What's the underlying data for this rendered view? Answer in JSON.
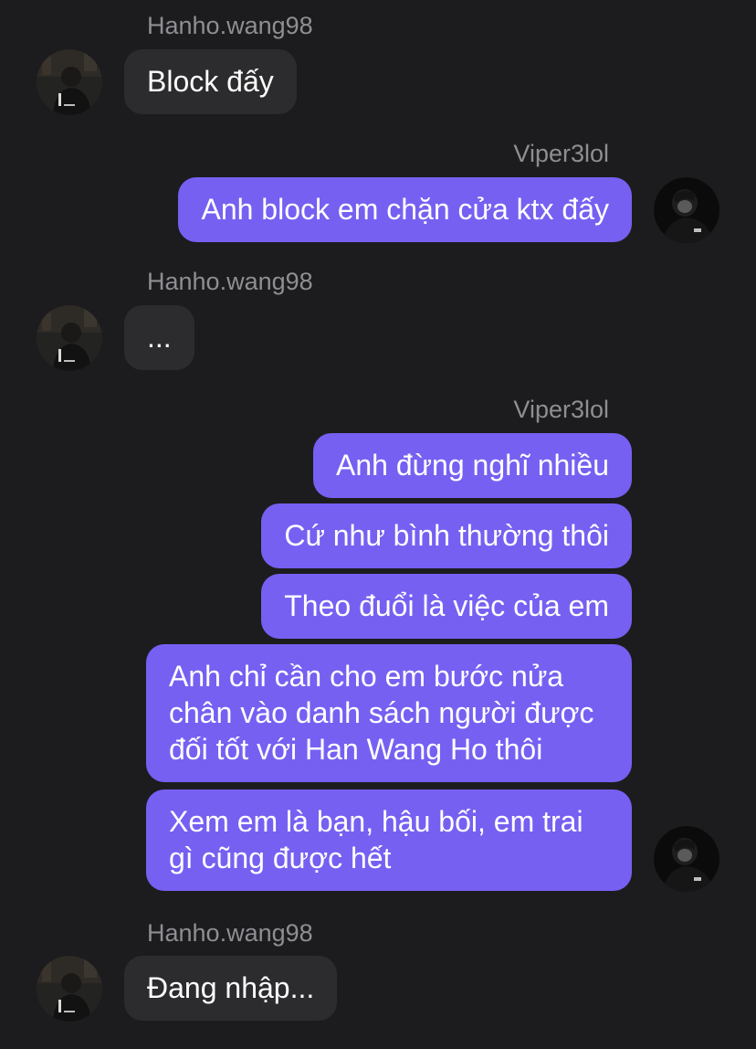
{
  "messages": {
    "g1": {
      "sender": "Hanho.wang98",
      "bubbles": [
        "Block đấy"
      ]
    },
    "g2": {
      "sender": "Viper3lol",
      "bubbles": [
        "Anh block em chặn cửa ktx đấy"
      ]
    },
    "g3": {
      "sender": "Hanho.wang98",
      "bubbles": [
        "..."
      ]
    },
    "g4": {
      "sender": "Viper3lol",
      "bubbles": [
        "Anh đừng nghĩ nhiều",
        "Cứ như bình thường thôi",
        "Theo đuổi là việc của em",
        "Anh chỉ cần cho em bước nửa chân vào danh sách người được đối tốt với Han Wang Ho thôi",
        "Xem em là bạn, hậu bối, em trai gì cũng được hết"
      ]
    },
    "g5": {
      "sender": "Hanho.wang98",
      "bubbles": [
        "Đang nhập..."
      ]
    }
  },
  "colors": {
    "background": "#1c1c1e",
    "incoming_bubble": "#2c2c2e",
    "outgoing_bubble": "#7660f2",
    "sender_name": "#8e8e93",
    "text": "#ffffff"
  },
  "icons": {
    "left_avatar": "user-avatar-photo",
    "right_avatar": "user-avatar-photo"
  }
}
